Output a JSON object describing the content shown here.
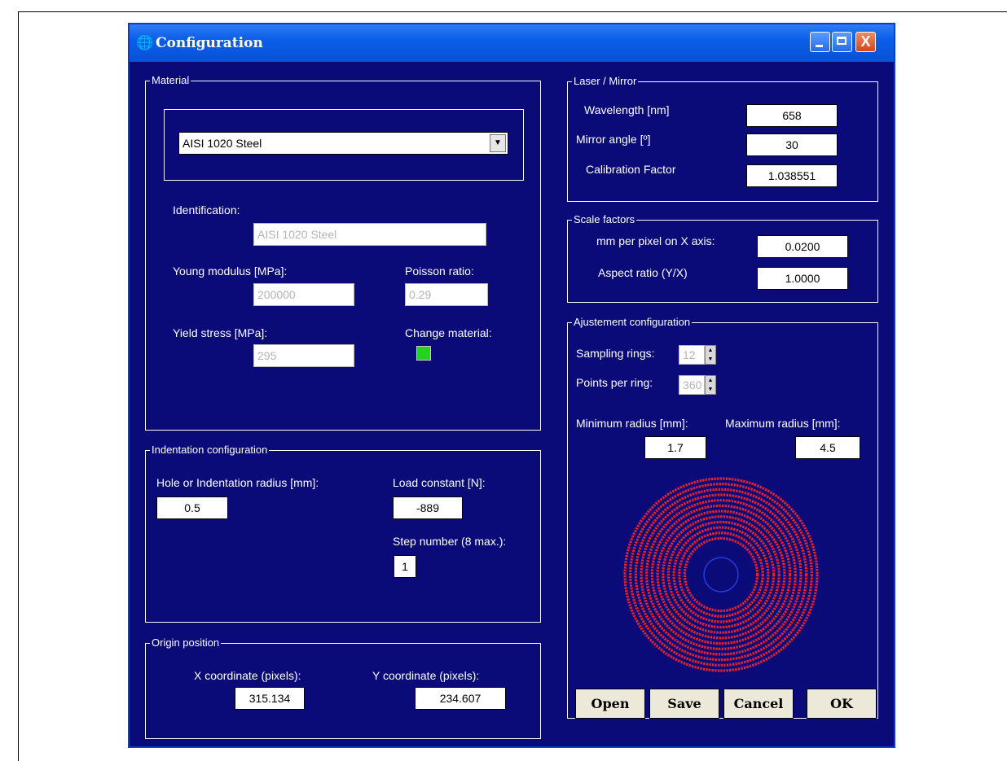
{
  "window": {
    "title": "Configuration",
    "close_glyph": "X"
  },
  "material": {
    "legend": "Material",
    "selected": "AISI 1020 Steel",
    "identification_label": "Identification:",
    "identification_value": "AISI 1020 Steel",
    "young_label": "Young modulus [MPa]:",
    "young_value": "200000",
    "poisson_label": "Poisson ratio:",
    "poisson_value": "0.29",
    "yield_label": "Yield stress [MPa]:",
    "yield_value": "295",
    "change_label": "Change material:",
    "change_color": "#22d322"
  },
  "indentation": {
    "legend": "Indentation configuration",
    "hole_label": "Hole or Indentation radius [mm]:",
    "hole_value": "0.5",
    "load_label": "Load constant [N]:",
    "load_value": "-889",
    "step_label": "Step number (8 max.):",
    "step_value": "1"
  },
  "origin": {
    "legend": "Origin position",
    "x_label": "X coordinate (pixels):",
    "x_value": "315.134",
    "y_label": "Y coordinate (pixels):",
    "y_value": "234.607"
  },
  "laser": {
    "legend": "Laser / Mirror",
    "wavelength_label": "Wavelength [nm]",
    "wavelength_value": "658",
    "mirror_label": "Mirror angle [º]",
    "mirror_value": "30",
    "calib_label": "Calibration Factor",
    "calib_value": "1.038551"
  },
  "scale": {
    "legend": "Scale factors",
    "mm_label": "mm per pixel on X axis:",
    "mm_value": "0.0200",
    "aspect_label": "Aspect ratio (Y/X)",
    "aspect_value": "1.0000"
  },
  "ajust": {
    "legend": "Ajustement configuration",
    "rings_label": "Sampling rings:",
    "rings_value": "12",
    "points_label": "Points per ring:",
    "points_value": "360",
    "min_label": "Minimum radius [mm]:",
    "min_value": "1.7",
    "max_label": "Maximum radius [mm]:",
    "max_value": "4.5",
    "dot_color": "#e8222a",
    "inner_circle_color": "#2a3ad8"
  },
  "buttons": {
    "open": "Open",
    "save": "Save",
    "cancel": "Cancel",
    "ok": "OK"
  },
  "colors": {
    "background": "#0a0a78",
    "titlebar": "#0a5ee8"
  }
}
